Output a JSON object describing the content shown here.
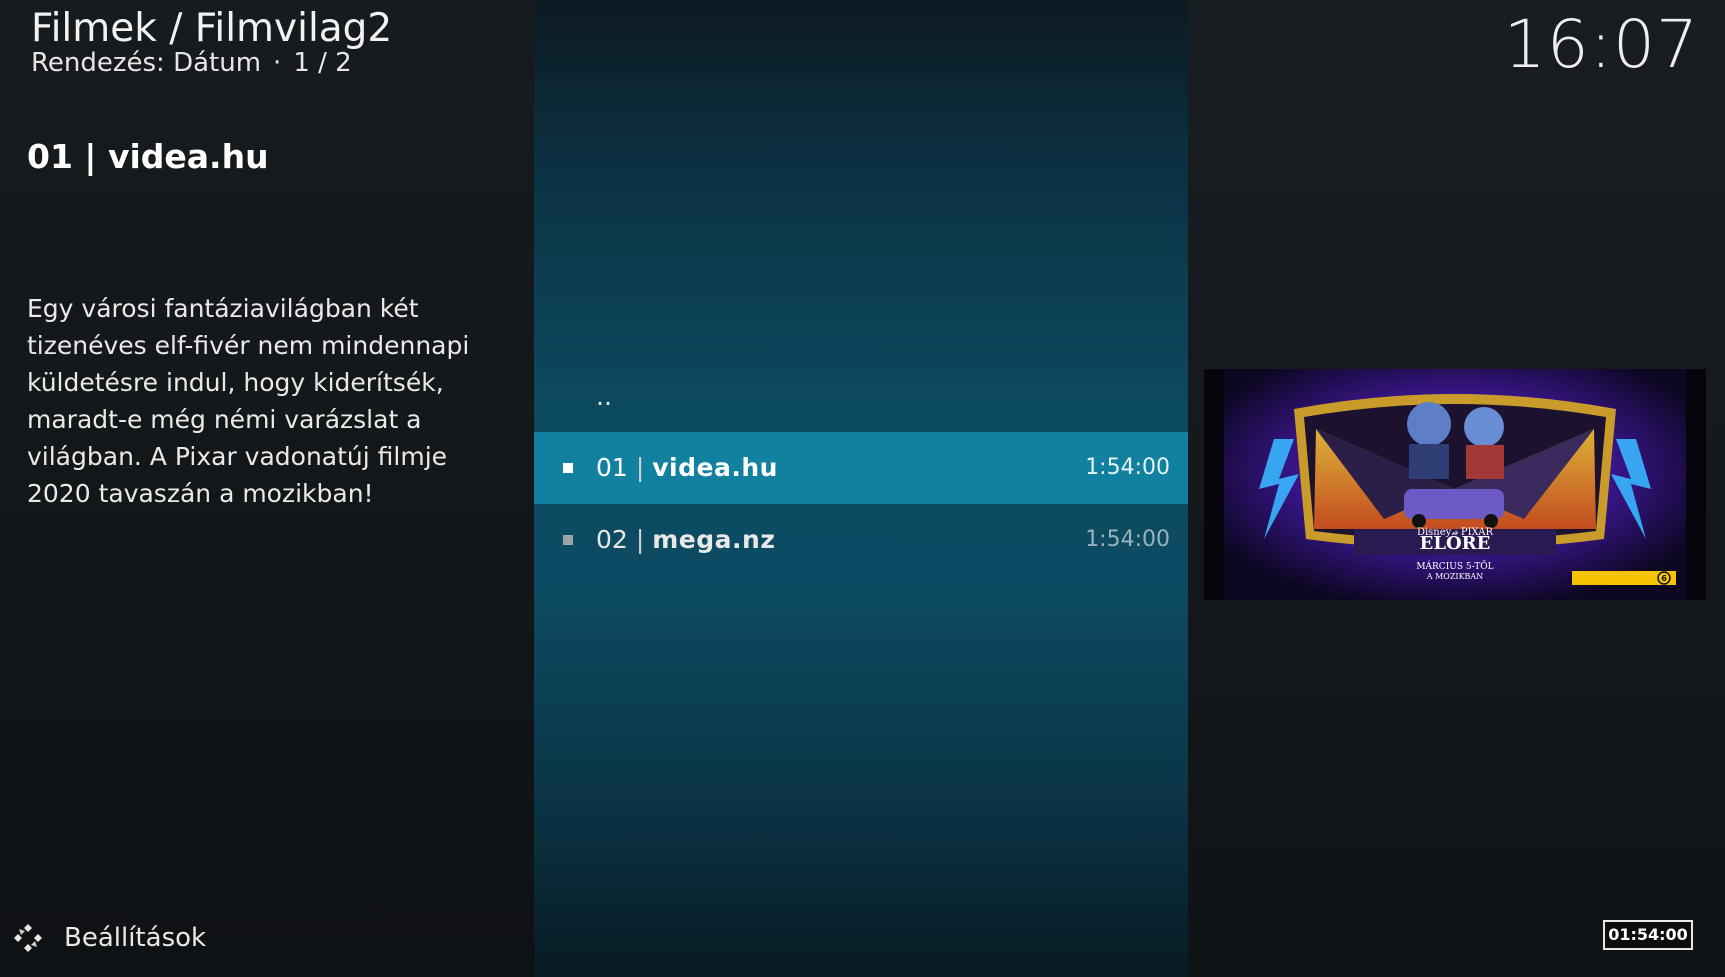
{
  "header": {
    "title": "Filmek / Filmvilag2",
    "sort_label": "Rendezés: Dátum",
    "separator": "·",
    "page_indicator": "1 / 2"
  },
  "clock": "16:07",
  "info": {
    "title": "01 | videa.hu",
    "plot": "Egy városi fantáziavilágban két tizenéves elf-fivér nem mindennapi küldetésre indul, hogy kiderítsék, maradt-e még némi varázslat a világban. A Pixar vadonatúj filmje 2020 tavaszán a mozikban!"
  },
  "list": {
    "parent_label": "..",
    "items": [
      {
        "number": "01",
        "separator": "|",
        "name": "videa.hu",
        "duration": "1:54:00",
        "selected": true
      },
      {
        "number": "02",
        "separator": "|",
        "name": "mega.nz",
        "duration": "1:54:00",
        "selected": false
      }
    ]
  },
  "poster": {
    "studio": "Disney · PIXAR",
    "title": "ELŐRE",
    "tagline": "MÁRCIUS 5-TŐL",
    "tagline2": "A MOZIKBAN",
    "rating": "6"
  },
  "footer": {
    "settings_label": "Beállítások",
    "settings_icon": "settings-icon",
    "duration_badge": "01:54:00"
  },
  "colors": {
    "accent": "#12809f",
    "background": "#111518",
    "center_panel": "#0c4a60"
  }
}
